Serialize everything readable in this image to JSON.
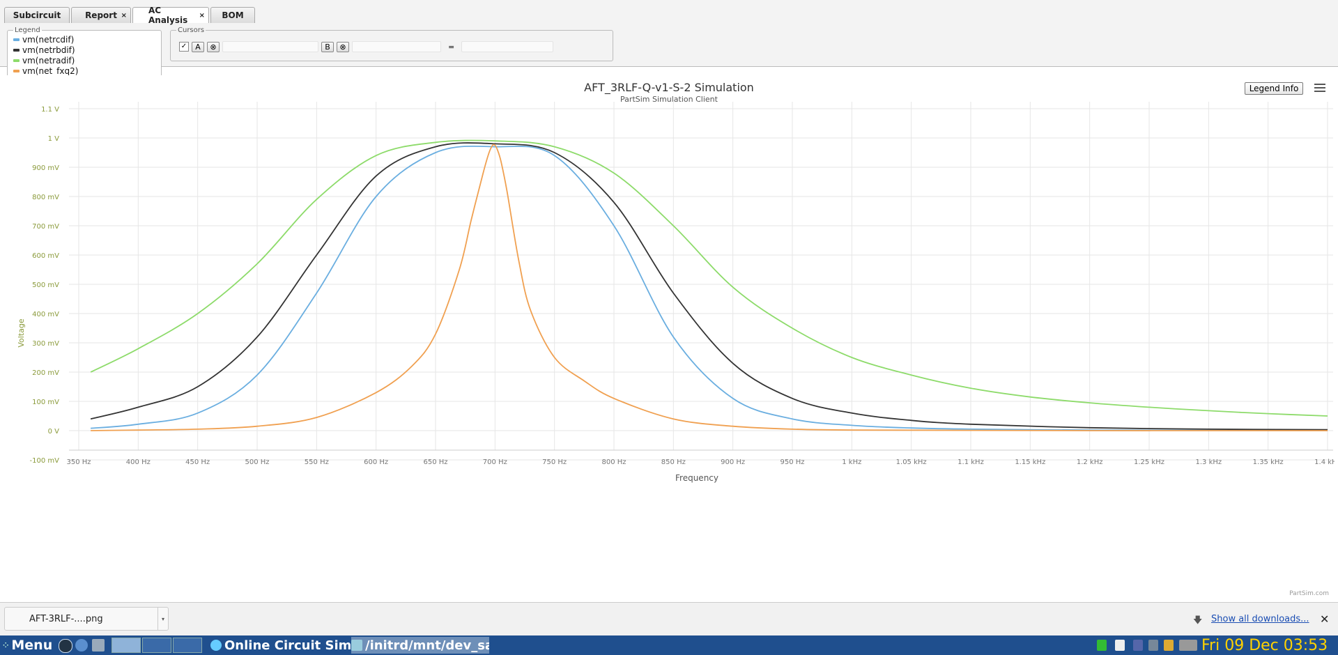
{
  "tabs": [
    {
      "label": "Subcircuit",
      "closable": false
    },
    {
      "label": "Report",
      "closable": true
    },
    {
      "label": "AC Analysis",
      "closable": true,
      "active": true
    },
    {
      "label": "BOM",
      "closable": false
    }
  ],
  "tab_close_glyph": "×",
  "legend_panel": {
    "title": "Legend",
    "items": [
      {
        "label": "vm(netrcdif)",
        "color": "#6aaee0"
      },
      {
        "label": "vm(netrbdif)",
        "color": "#333333"
      },
      {
        "label": "vm(netradif)",
        "color": "#8ddb6a"
      },
      {
        "label": "vm(net_fxq2)",
        "color": "#f0a050"
      }
    ]
  },
  "cursors_panel": {
    "title": "Cursors",
    "checkbox_glyph": "✓",
    "a_label": "A",
    "b_label": "B",
    "clear_glyph": "⊗",
    "equals": "="
  },
  "chart": {
    "legend_info_label": "Legend Info",
    "credit": "PartSim.com"
  },
  "chart_data": {
    "type": "line",
    "title": "AFT_3RLF-Q-v1-S-2 Simulation",
    "subtitle": "PartSim Simulation Client",
    "xlabel": "Frequency",
    "ylabel": "Voltage",
    "xlim": [
      350,
      1400
    ],
    "ylim": [
      -0.1,
      1.1
    ],
    "x_ticks": [
      {
        "value": 350,
        "label": "350 Hz"
      },
      {
        "value": 400,
        "label": "400 Hz"
      },
      {
        "value": 450,
        "label": "450 Hz"
      },
      {
        "value": 500,
        "label": "500 Hz"
      },
      {
        "value": 550,
        "label": "550 Hz"
      },
      {
        "value": 600,
        "label": "600 Hz"
      },
      {
        "value": 650,
        "label": "650 Hz"
      },
      {
        "value": 700,
        "label": "700 Hz"
      },
      {
        "value": 750,
        "label": "750 Hz"
      },
      {
        "value": 800,
        "label": "800 Hz"
      },
      {
        "value": 850,
        "label": "850 Hz"
      },
      {
        "value": 900,
        "label": "900 Hz"
      },
      {
        "value": 950,
        "label": "950 Hz"
      },
      {
        "value": 1000,
        "label": "1 kHz"
      },
      {
        "value": 1050,
        "label": "1.05 kHz"
      },
      {
        "value": 1100,
        "label": "1.1 kHz"
      },
      {
        "value": 1150,
        "label": "1.15 kHz"
      },
      {
        "value": 1200,
        "label": "1.2 kHz"
      },
      {
        "value": 1250,
        "label": "1.25 kHz"
      },
      {
        "value": 1300,
        "label": "1.3 kHz"
      },
      {
        "value": 1350,
        "label": "1.35 kHz"
      },
      {
        "value": 1400,
        "label": "1.4 kHz"
      }
    ],
    "y_ticks": [
      {
        "value": 1.1,
        "label": "1.1 V"
      },
      {
        "value": 1.0,
        "label": "1 V"
      },
      {
        "value": 0.9,
        "label": "900 mV"
      },
      {
        "value": 0.8,
        "label": "800 mV"
      },
      {
        "value": 0.7,
        "label": "700 mV"
      },
      {
        "value": 0.6,
        "label": "600 mV"
      },
      {
        "value": 0.5,
        "label": "500 mV"
      },
      {
        "value": 0.4,
        "label": "400 mV"
      },
      {
        "value": 0.3,
        "label": "300 mV"
      },
      {
        "value": 0.2,
        "label": "200 mV"
      },
      {
        "value": 0.1,
        "label": "100 mV"
      },
      {
        "value": 0.0,
        "label": "0 V"
      },
      {
        "value": -0.1,
        "label": "-100 mV"
      }
    ],
    "grid": true,
    "series": [
      {
        "name": "vm(netrcdif)",
        "color": "#6aaee0",
        "x": [
          360,
          400,
          450,
          500,
          550,
          600,
          650,
          700,
          750,
          800,
          850,
          900,
          950,
          1000,
          1050,
          1100,
          1200,
          1300,
          1400
        ],
        "y": [
          0.008,
          0.022,
          0.06,
          0.19,
          0.47,
          0.8,
          0.95,
          0.97,
          0.94,
          0.7,
          0.32,
          0.11,
          0.04,
          0.018,
          0.009,
          0.005,
          0.002,
          0.001,
          0.001
        ]
      },
      {
        "name": "vm(netrbdif)",
        "color": "#333333",
        "x": [
          360,
          400,
          450,
          500,
          550,
          600,
          650,
          700,
          750,
          800,
          850,
          900,
          950,
          1000,
          1050,
          1100,
          1200,
          1300,
          1400
        ],
        "y": [
          0.04,
          0.08,
          0.15,
          0.32,
          0.6,
          0.87,
          0.97,
          0.98,
          0.95,
          0.78,
          0.47,
          0.23,
          0.11,
          0.06,
          0.035,
          0.022,
          0.01,
          0.005,
          0.003
        ]
      },
      {
        "name": "vm(netradif)",
        "color": "#8ddb6a",
        "x": [
          360,
          400,
          450,
          500,
          550,
          600,
          650,
          700,
          750,
          800,
          850,
          900,
          950,
          1000,
          1050,
          1100,
          1150,
          1200,
          1250,
          1300,
          1350,
          1400
        ],
        "y": [
          0.2,
          0.28,
          0.4,
          0.57,
          0.79,
          0.94,
          0.985,
          0.99,
          0.97,
          0.88,
          0.7,
          0.49,
          0.35,
          0.25,
          0.19,
          0.145,
          0.115,
          0.095,
          0.08,
          0.068,
          0.058,
          0.05
        ]
      },
      {
        "name": "vm(net_fxq2)",
        "color": "#f0a050",
        "x": [
          360,
          400,
          450,
          500,
          550,
          600,
          630,
          650,
          670,
          680,
          690,
          695,
          698,
          700,
          702,
          705,
          710,
          720,
          730,
          750,
          775,
          800,
          850,
          900,
          950,
          1000,
          1100,
          1200,
          1300,
          1400
        ],
        "y": [
          0.0,
          0.002,
          0.005,
          0.015,
          0.045,
          0.13,
          0.22,
          0.33,
          0.55,
          0.72,
          0.88,
          0.95,
          0.975,
          0.975,
          0.96,
          0.92,
          0.82,
          0.58,
          0.41,
          0.25,
          0.17,
          0.11,
          0.04,
          0.015,
          0.005,
          0.002,
          0.001,
          0.0,
          0.0,
          0.0
        ]
      }
    ]
  },
  "downloads": {
    "file_name": "AFT-3RLF-....png",
    "show_all_label": "Show all downloads...",
    "download_glyph": "🡇",
    "close_glyph": "✕"
  },
  "taskbar": {
    "menu_label": "Menu",
    "task1": "Online Circuit Sim",
    "task2": "/initrd/mnt/dev_sa",
    "clock": "Fri 09 Dec 03:53"
  }
}
